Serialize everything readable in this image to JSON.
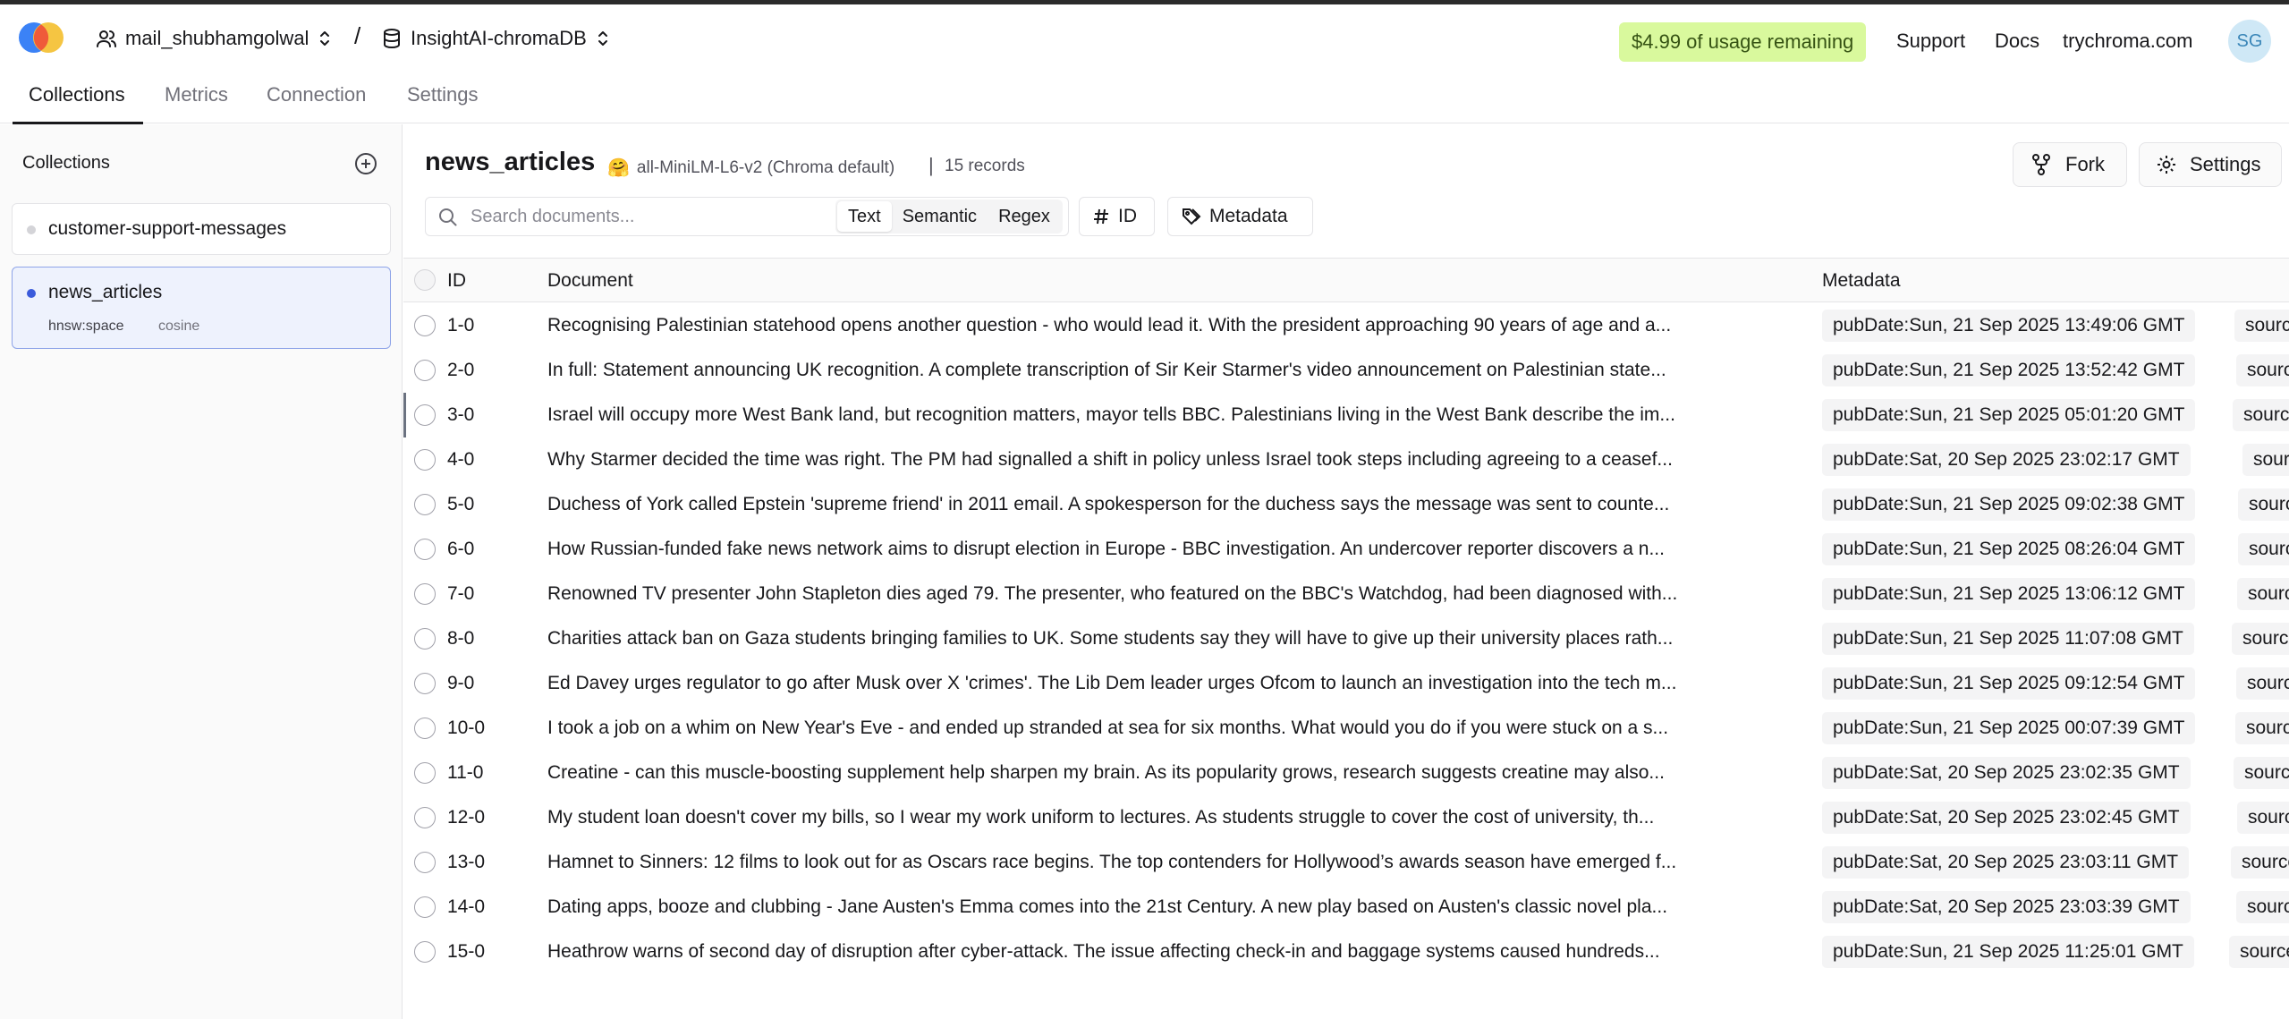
{
  "header": {
    "org": "mail_shubhamgolwal",
    "separator": "/",
    "database": "InsightAI-chromaDB",
    "usage": "$4.99 of usage remaining",
    "links": [
      "Support",
      "Docs",
      "trychroma.com"
    ],
    "avatar": "SG"
  },
  "tabs": [
    "Collections",
    "Metrics",
    "Connection",
    "Settings"
  ],
  "sidebar": {
    "title": "Collections",
    "collections": [
      {
        "name": "customer-support-messages"
      },
      {
        "name": "news_articles",
        "space": "hnsw:space",
        "metric": "cosine"
      }
    ]
  },
  "main": {
    "collection_name": "news_articles",
    "embedding_emoji": "🤗",
    "embedding": "all-MiniLM-L6-v2 (Chroma default)",
    "pipe": "|",
    "records": "15 records",
    "fork_label": "Fork",
    "settings_label": "Settings",
    "search_placeholder": "Search documents...",
    "search_modes": [
      "Text",
      "Semantic",
      "Regex"
    ],
    "id_filter": "ID",
    "metadata_filter": "Metadata",
    "columns": [
      "ID",
      "Document",
      "Metadata"
    ]
  },
  "rows": [
    {
      "id": "1-0",
      "doc": "Recognising Palestinian statehood opens another question - who would lead it. With the president approaching 90 years of age and a...",
      "meta": "pubDate:Sun, 21 Sep 2025 13:49:06 GMT",
      "source": "source"
    },
    {
      "id": "2-0",
      "doc": "In full: Statement announcing UK recognition. A complete transcription of Sir Keir Starmer's video announcement on Palestinian state...",
      "meta": "pubDate:Sun, 21 Sep 2025 13:52:42 GMT",
      "source": "source"
    },
    {
      "id": "3-0",
      "doc": "Israel will occupy more West Bank land, but recognition matters, mayor tells BBC. Palestinians living in the West Bank describe the im...",
      "meta": "pubDate:Sun, 21 Sep 2025 05:01:20 GMT",
      "source": "source"
    },
    {
      "id": "4-0",
      "doc": "Why Starmer decided the time was right. The PM had signalled a shift in policy unless Israel took steps including agreeing to a ceasef...",
      "meta": "pubDate:Sat, 20 Sep 2025 23:02:17 GMT",
      "source": "source"
    },
    {
      "id": "5-0",
      "doc": "Duchess of York called Epstein 'supreme friend' in 2011 email. A spokesperson for the duchess says the message was sent to counte...",
      "meta": "pubDate:Sun, 21 Sep 2025 09:02:38 GMT",
      "source": "source"
    },
    {
      "id": "6-0",
      "doc": "How Russian-funded fake news network aims to disrupt election in Europe - BBC investigation. An undercover reporter discovers a n...",
      "meta": "pubDate:Sun, 21 Sep 2025 08:26:04 GMT",
      "source": "source"
    },
    {
      "id": "7-0",
      "doc": "Renowned TV presenter John Stapleton dies aged 79. The presenter, who featured on the BBC's Watchdog, had been diagnosed with...",
      "meta": "pubDate:Sun, 21 Sep 2025 13:06:12 GMT",
      "source": "source"
    },
    {
      "id": "8-0",
      "doc": "Charities attack ban on Gaza students bringing families to UK. Some students say they will have to give up their university places rath...",
      "meta": "pubDate:Sun, 21 Sep 2025 11:07:08 GMT",
      "source": "source"
    },
    {
      "id": "9-0",
      "doc": "Ed Davey urges regulator to go after Musk over X 'crimes'. The Lib Dem leader urges Ofcom to launch an investigation into the tech m...",
      "meta": "pubDate:Sun, 21 Sep 2025 09:12:54 GMT",
      "source": "source"
    },
    {
      "id": "10-0",
      "doc": "I took a job on a whim on New Year's Eve - and ended up stranded at sea for six months. What would you do if you were stuck on a s...",
      "meta": "pubDate:Sun, 21 Sep 2025 00:07:39 GMT",
      "source": "source"
    },
    {
      "id": "11-0",
      "doc": "Creatine - can this muscle-boosting supplement help sharpen my brain. As its popularity grows, research suggests creatine may also...",
      "meta": "pubDate:Sat, 20 Sep 2025 23:02:35 GMT",
      "source": "source"
    },
    {
      "id": "12-0",
      "doc": "My student loan doesn't cover my bills, so I wear my work uniform to lectures. As students struggle to cover the cost of university, th...",
      "meta": "pubDate:Sat, 20 Sep 2025 23:02:45 GMT",
      "source": "source"
    },
    {
      "id": "13-0",
      "doc": "Hamnet to Sinners: 12 films to look out for as Oscars race begins. The top contenders for Hollywood’s awards season have emerged f...",
      "meta": "pubDate:Sat, 20 Sep 2025 23:03:11 GMT",
      "source": "source"
    },
    {
      "id": "14-0",
      "doc": "Dating apps, booze and clubbing - Jane Austen's Emma comes into the 21st Century. A new play based on Austen's classic novel pla...",
      "meta": "pubDate:Sat, 20 Sep 2025 23:03:39 GMT",
      "source": "source"
    },
    {
      "id": "15-0",
      "doc": "Heathrow warns of second day of disruption after cyber-attack. The issue affecting check-in and baggage systems caused hundreds...",
      "meta": "pubDate:Sun, 21 Sep 2025 11:25:01 GMT",
      "source": "source"
    }
  ]
}
